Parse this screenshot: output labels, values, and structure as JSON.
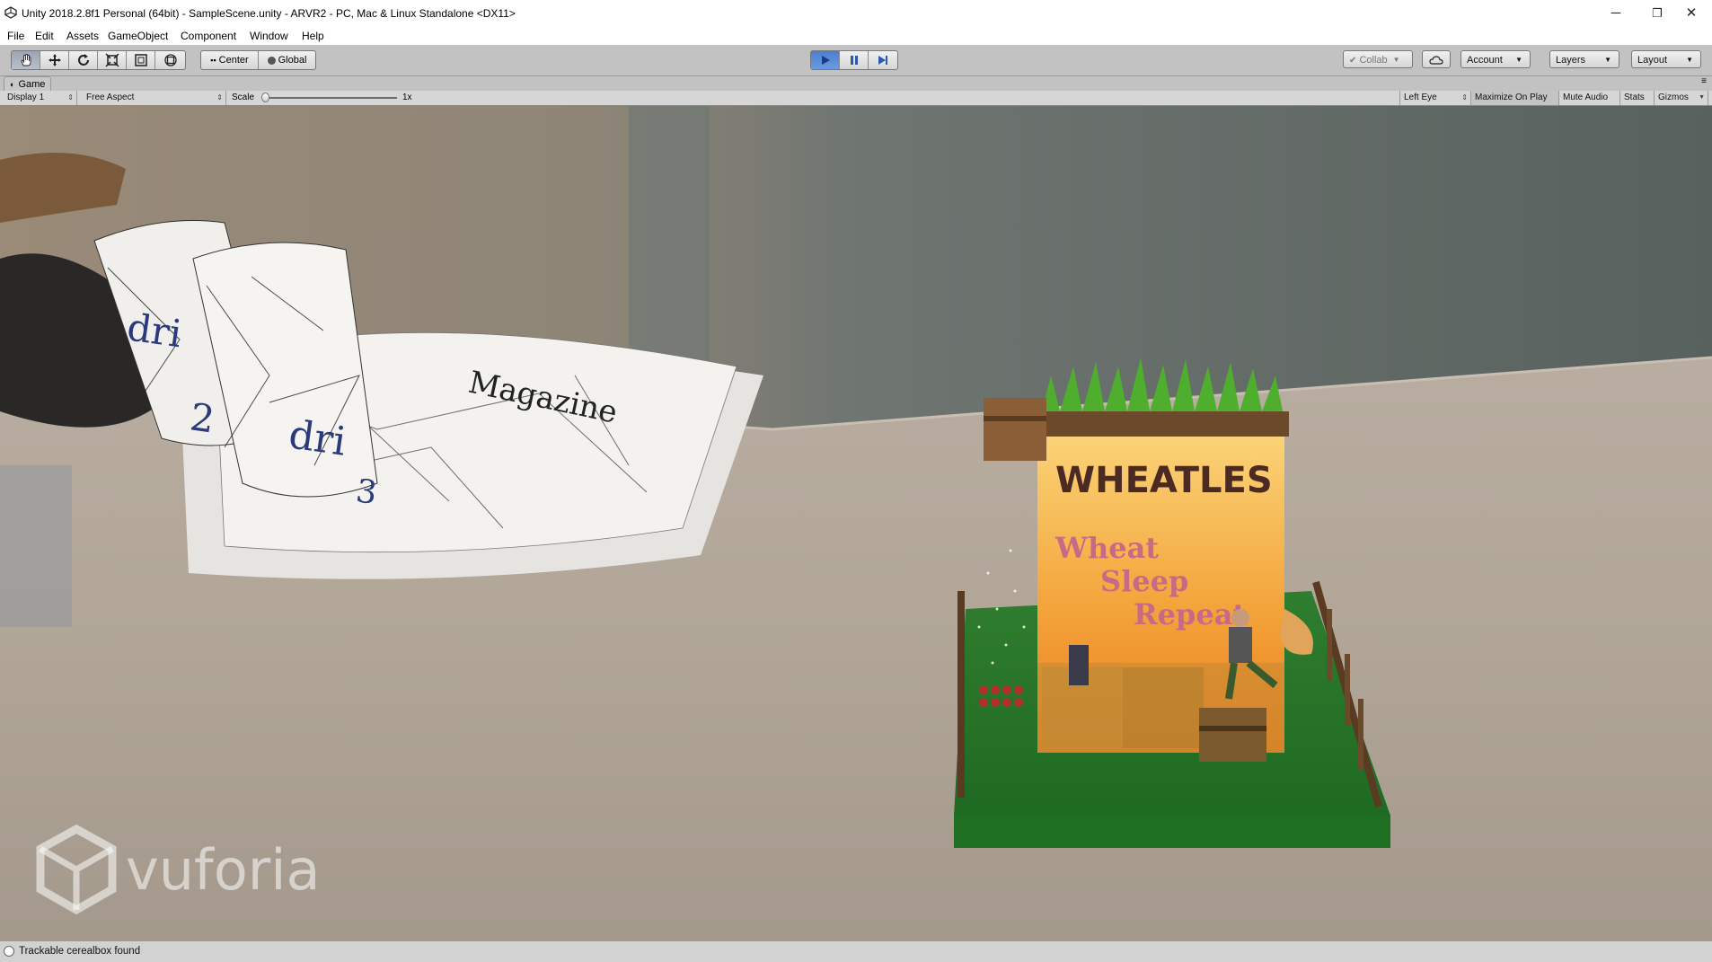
{
  "window": {
    "title": "Unity 2018.2.8f1 Personal (64bit) - SampleScene.unity - ARVR2 - PC, Mac & Linux Standalone <DX11>",
    "controls": {
      "minimize": "─",
      "restore": "❐",
      "close": "✕"
    }
  },
  "menu": {
    "items": [
      "File",
      "Edit",
      "Assets",
      "GameObject",
      "Component",
      "Window",
      "Help"
    ]
  },
  "toolbar": {
    "tools": [
      "hand-icon",
      "move-icon",
      "rotate-icon",
      "scale-icon",
      "rect-icon",
      "transform-icon"
    ],
    "pivot_mode": "Center",
    "pivot_rotation": "Global",
    "play_state": "playing",
    "collab": "Collab",
    "account": "Account",
    "layers": "Layers",
    "layout": "Layout"
  },
  "game_view": {
    "tab": "Game",
    "display": "Display 1",
    "aspect": "Free Aspect",
    "scale_label": "Scale",
    "scale_value": "1x",
    "scale_level": 0.0,
    "eye": "Left Eye",
    "options": [
      "Maximize On Play",
      "Mute Audio",
      "Stats",
      "Gizmos"
    ]
  },
  "scene": {
    "cereal_box": {
      "brand": "WHEATLES",
      "tagline": [
        "Wheat",
        "Sleep",
        "Repeat"
      ]
    },
    "cup_text": [
      "dri",
      "2",
      "dri",
      "3"
    ],
    "magazine_text": "Magazine",
    "watermark": "vuforia"
  },
  "status": {
    "message": "Trackable cerealbox found"
  },
  "colors": {
    "titlebar": "#ffffff",
    "toolbar": "#c2c2c2",
    "play_active": "#4a7fd0",
    "grass": "#2e8b2e",
    "box_orange": "#f0a020",
    "tagline": "#c06080"
  }
}
